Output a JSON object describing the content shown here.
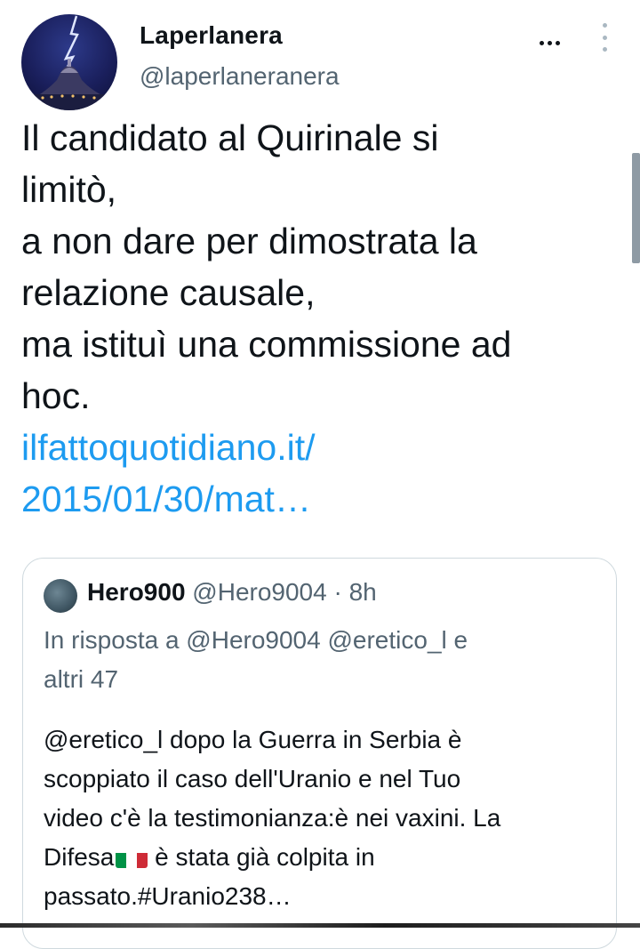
{
  "tweet": {
    "author": {
      "display_name": "Laperlanera",
      "handle": "@laperlaneranera",
      "avatar_icon": "lightning-over-dome-icon"
    },
    "text_lines": [
      "Il candidato al Quirinale si",
      "limitò,",
      "a non dare per dimostrata la",
      "relazione causale,",
      "ma istituì una commissione ad",
      "hoc."
    ],
    "link_lines": [
      "ilfattoquotidiano.it/",
      "2015/01/30/mat…"
    ],
    "link_color": "#1d9bf0",
    "more_icon": "more-horizontal-icon"
  },
  "quoted_tweet": {
    "display_name": "Hero900",
    "handle": "@Hero9004",
    "separator": " · ",
    "time": "8h",
    "reply_context_lines": [
      "In risposta a @Hero9004 @eretico_l e",
      "altri 47"
    ],
    "text_lines": [
      "@eretico_l dopo la Guerra in Serbia è",
      "scoppiato il caso dell'Uranio e nel Tuo",
      "video c'è la testimonianza:è nei vaxini. La"
    ],
    "text_line4_start": "Difesa",
    "flag_emoji": "italy-flag-icon",
    "text_line4_end": " è stata già colpita in",
    "text_line5": "passato.#Uranio238…"
  }
}
